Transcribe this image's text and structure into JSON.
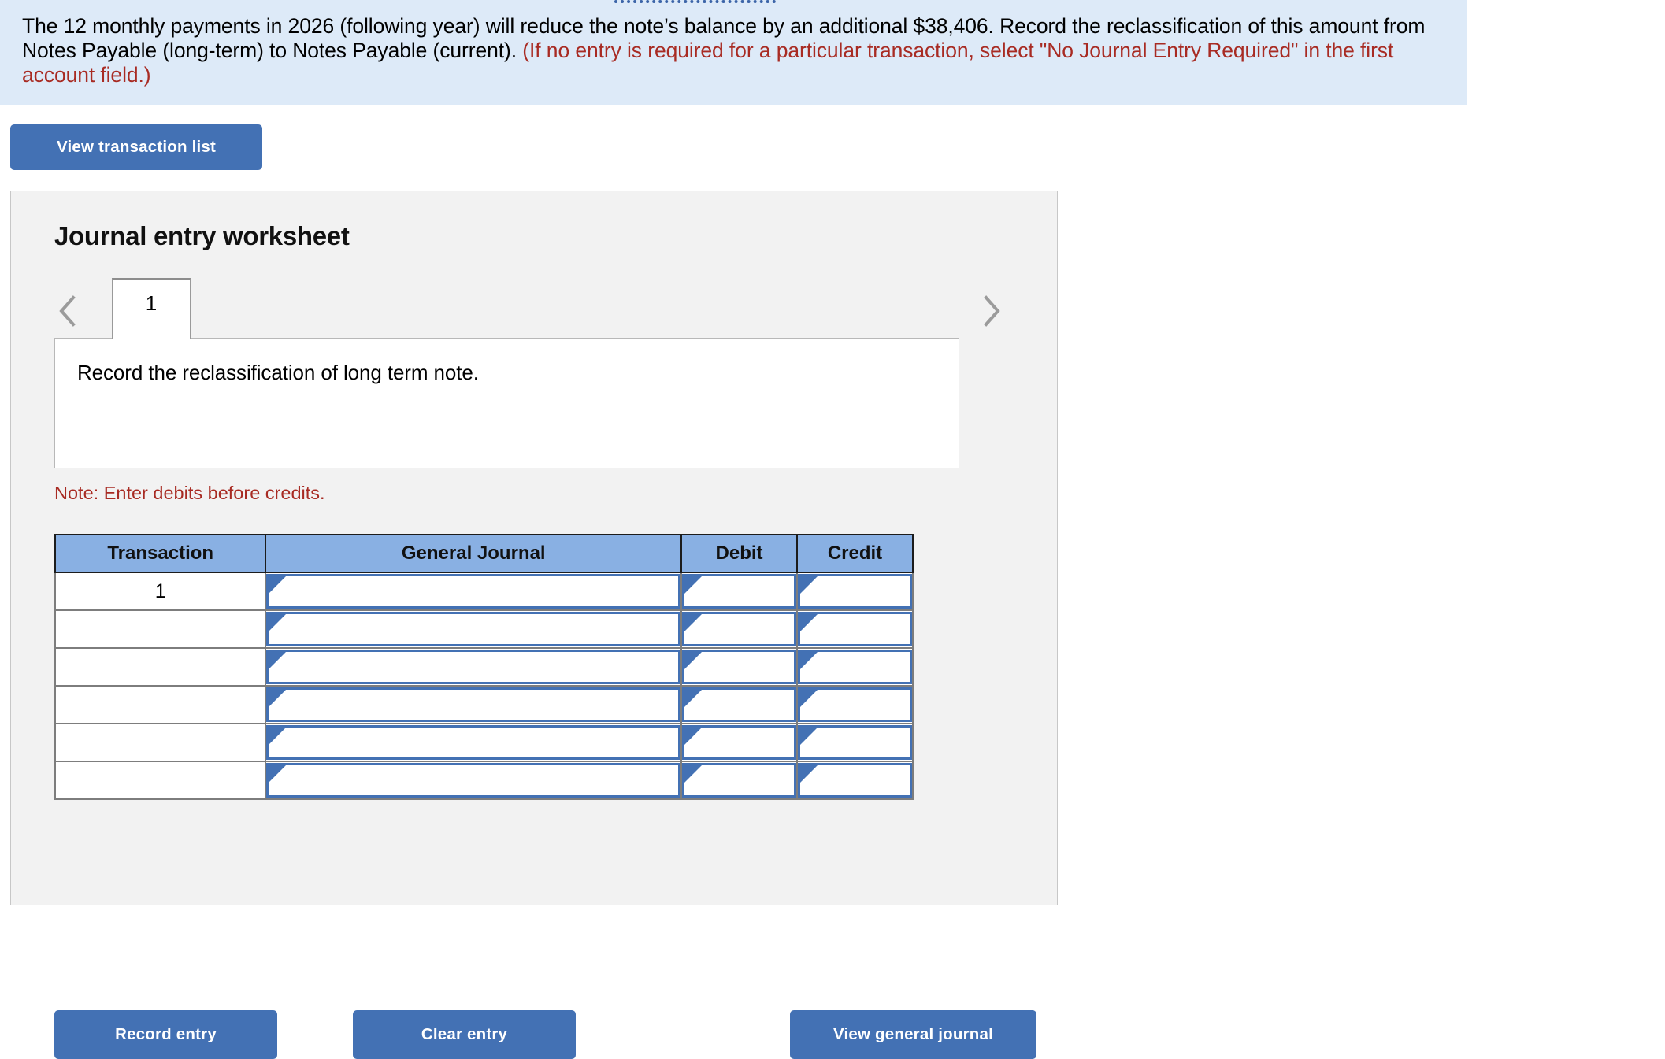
{
  "instruction": {
    "main_text": "The 12 monthly payments in 2026 (following year) will reduce the note’s balance by an additional $38,406. Record the reclassification of this amount from Notes Payable (long-term) to Notes Payable (current). ",
    "red_text": "(If no entry is required for a particular transaction, select \"No Journal Entry Required\" in the first account field.)"
  },
  "toolbar": {
    "view_transaction_list_label": "View transaction list"
  },
  "worksheet": {
    "title": "Journal entry worksheet",
    "tabs": [
      {
        "label": "1",
        "active": true
      }
    ],
    "prev_icon": "chevron-left-icon",
    "next_icon": "chevron-right-icon",
    "description": "Record the reclassification of long term note.",
    "note": "Note: Enter debits before credits."
  },
  "table": {
    "headers": [
      "Transaction",
      "General Journal",
      "Debit",
      "Credit"
    ],
    "rows": [
      {
        "transaction": "1",
        "general_journal": "",
        "debit": "",
        "credit": ""
      },
      {
        "transaction": "",
        "general_journal": "",
        "debit": "",
        "credit": ""
      },
      {
        "transaction": "",
        "general_journal": "",
        "debit": "",
        "credit": ""
      },
      {
        "transaction": "",
        "general_journal": "",
        "debit": "",
        "credit": ""
      },
      {
        "transaction": "",
        "general_journal": "",
        "debit": "",
        "credit": ""
      },
      {
        "transaction": "",
        "general_journal": "",
        "debit": "",
        "credit": ""
      }
    ]
  },
  "footer": {
    "record_entry_label": "Record entry",
    "clear_entry_label": "Clear entry",
    "view_general_journal_label": "View general journal"
  },
  "colors": {
    "banner_background": "#ddeaf8",
    "button_blue": "#4371b4",
    "table_header_blue": "#89b0e3",
    "panel_gray": "#f2f2f2",
    "red_note": "#a82b23"
  }
}
